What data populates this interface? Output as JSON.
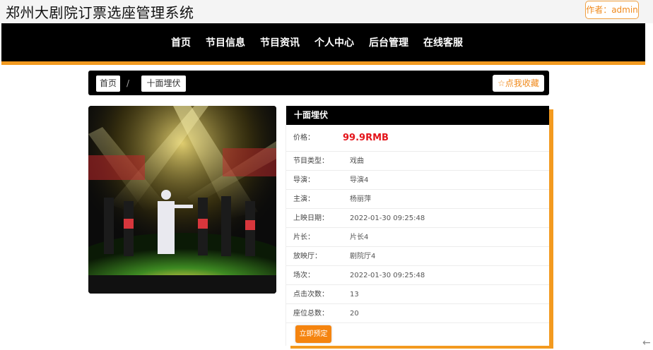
{
  "header": {
    "site_title": "郑州大剧院订票选座管理系统",
    "author_label": "作者：admin"
  },
  "nav": {
    "items": [
      "首页",
      "节目信息",
      "节目资讯",
      "个人中心",
      "后台管理",
      "在线客服"
    ]
  },
  "breadcrumb": {
    "home": "首页",
    "separator": "/",
    "current": "十面埋伏",
    "favorite_button": "☆点我收藏"
  },
  "detail": {
    "title": "十面埋伏",
    "price_label": "价格：",
    "price_value": "99.9RMB",
    "fields": [
      {
        "label": "节目类型：",
        "value": "戏曲"
      },
      {
        "label": "导演：",
        "value": "导演4"
      },
      {
        "label": "主演：",
        "value": "杨丽萍"
      },
      {
        "label": "上映日期：",
        "value": "2022-01-30 09:25:48"
      },
      {
        "label": "片长：",
        "value": "片长4"
      },
      {
        "label": "放映厅：",
        "value": "剧院厅4"
      },
      {
        "label": "场次：",
        "value": "2022-01-30 09:25:48"
      },
      {
        "label": "点击次数：",
        "value": "13"
      },
      {
        "label": "座位总数：",
        "value": "20"
      }
    ],
    "book_button": "立即预定"
  },
  "colors": {
    "accent": "#f39a1f",
    "price": "#e4151b",
    "nav_bg": "#000000"
  },
  "icons": {
    "back": "arrow-left-icon"
  }
}
